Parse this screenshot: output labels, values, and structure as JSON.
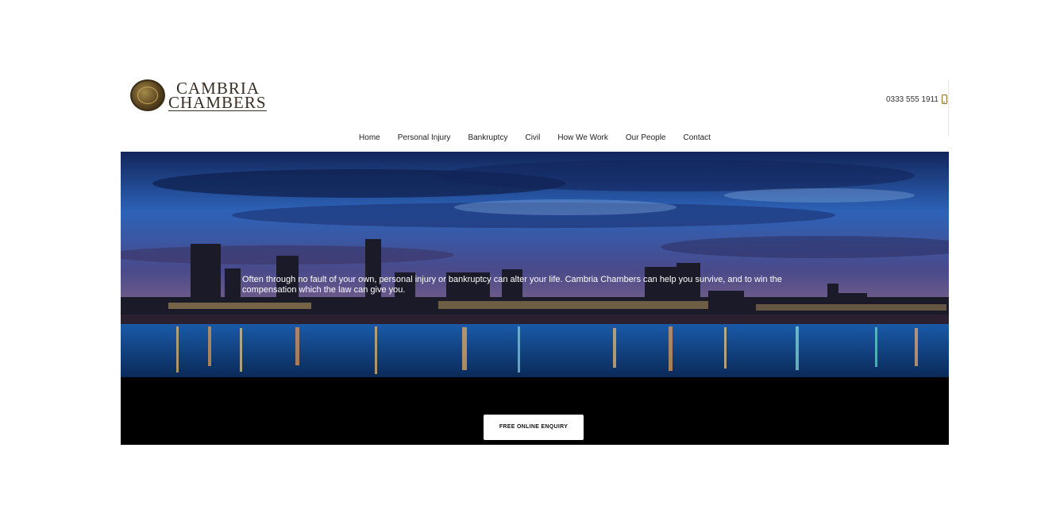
{
  "brand": {
    "line1": "CAMBRIA",
    "line2": "CHAMBERS"
  },
  "phone": {
    "number": "0333 555 1911"
  },
  "nav": [
    "Home",
    "Personal Injury",
    "Bankruptcy",
    "Civil",
    "How We Work",
    "Our People",
    "Contact"
  ],
  "hero": {
    "text": "Often through no fault of your own, personal injury or bankruptcy can alter your life. Cambria Chambers can help you survive, and to win the compensation which the law can give you."
  },
  "cta": {
    "label": "FREE ONLINE ENQUIRY"
  }
}
